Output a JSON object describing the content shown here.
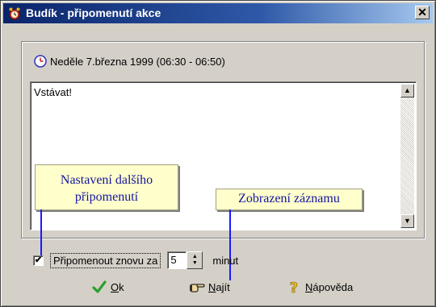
{
  "window": {
    "title": "Budík - připomenutí akce",
    "close_symbol": "✕"
  },
  "event": {
    "date_text": "Neděle 7.března 1999 (06:30 - 06:50)",
    "note": "Vstávat!"
  },
  "annotations": {
    "settings_callout_line1": "Nastavení dalšího",
    "settings_callout_line2": "připomenutí",
    "record_callout": "Zobrazení záznamu"
  },
  "remind_again": {
    "checked": true,
    "check_mark": "✔",
    "label": "Připomenout znovu za",
    "minutes_value": "5",
    "unit": "minut"
  },
  "buttons": {
    "ok": {
      "underlined": "O",
      "rest": "k"
    },
    "find": {
      "underlined": "N",
      "rest": "ajít"
    },
    "help": {
      "underlined": "N",
      "rest": "ápověda"
    }
  },
  "icons": {
    "title": "alarm-clock-icon",
    "date": "clock-icon",
    "ok": "checkmark-icon",
    "find": "pointing-hand-icon",
    "help": "question-mark-icon"
  },
  "colors": {
    "title_bar": "#0a246a",
    "callout_background": "#ffffcc",
    "callout_text": "#1414a0",
    "callout_line": "#1a1aff",
    "ok_icon": "#2ca02c",
    "help_icon": "#e8c020"
  }
}
